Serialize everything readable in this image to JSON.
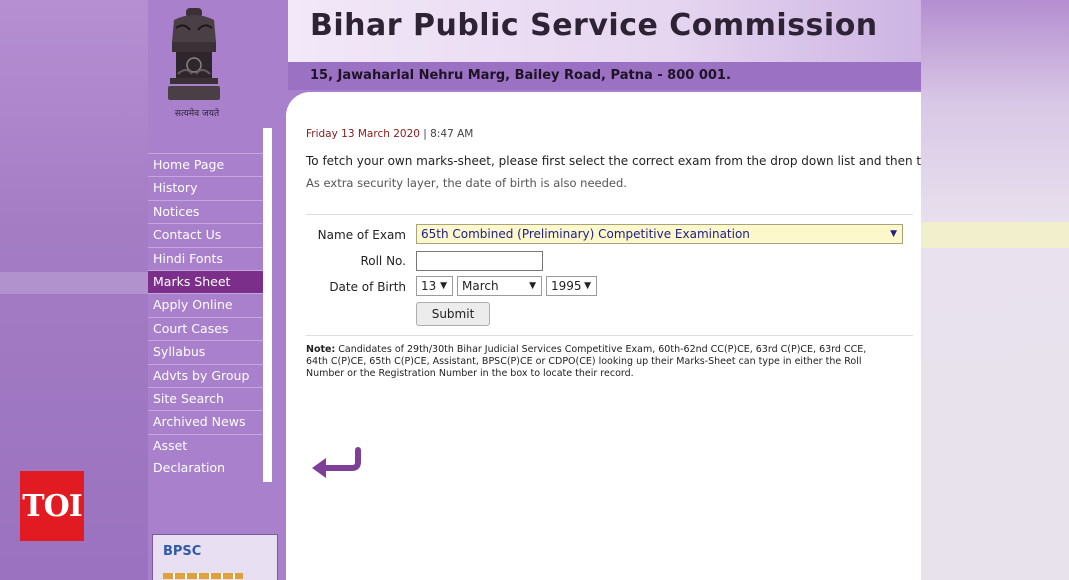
{
  "header": {
    "title": "Bihar Public Service Commission",
    "address": "15, Jawaharlal Nehru Marg, Bailey Road, Patna - 800 001.",
    "emblem_caption": "सत्यमेव जयते"
  },
  "nav": {
    "items": [
      {
        "label": "Home Page"
      },
      {
        "label": "History"
      },
      {
        "label": "Notices"
      },
      {
        "label": "Contact Us"
      },
      {
        "label": "Hindi Fonts"
      },
      {
        "label": "Marks Sheet"
      },
      {
        "label": "Apply Online"
      },
      {
        "label": "Court Cases"
      },
      {
        "label": "Syllabus"
      },
      {
        "label": "Advts by Group"
      },
      {
        "label": "Site Search"
      },
      {
        "label": "Archived News"
      },
      {
        "label": "Asset Declaration"
      }
    ],
    "active": "Marks Sheet",
    "bpsc_badge": "BPSC"
  },
  "main": {
    "date": "Friday 13 March 2020",
    "separator": "|",
    "time": "8:47 AM",
    "intro": "To fetch your own marks-sheet, please first select the correct exam from the drop down list and then type in y",
    "intro2": "As extra security layer, the date of birth is also needed.",
    "form": {
      "exam_label": "Name of Exam",
      "exam_value": "65th Combined (Preliminary) Competitive Examination",
      "roll_label": "Roll No.",
      "roll_value": "",
      "dob_label": "Date of Birth",
      "dob_day": "13",
      "dob_month": "March",
      "dob_year": "1995",
      "submit_label": "Submit"
    },
    "note_label": "Note:",
    "note_text": " Candidates of 29th/30th Bihar Judicial Services Competitive Exam, 60th-62nd CC(P)CE, 63rd C(P)CE, 63rd CCE, 64th C(P)CE,  65th C(P)CE, Assistant, BPSC(P)CE or CDPO(CE) looking up their Marks-Sheet can type in either the Roll Number or the Registration Number in the box to locate their record."
  },
  "watermark": "TOI",
  "colors": {
    "nav_bg": "#a880cc",
    "nav_active": "#7c2f8a",
    "date_color": "#8b1a1a",
    "exam_select_bg": "#fcf8cc",
    "toi_red": "#e21b22"
  }
}
